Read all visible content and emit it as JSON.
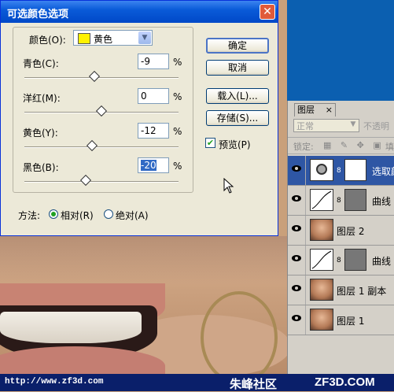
{
  "dialog": {
    "title": "可选颜色选项",
    "close_symbol": "✕",
    "colors_label": "颜色(O):",
    "colors_value": "黄色",
    "sliders": [
      {
        "label": "青色(C):",
        "value": "-9",
        "unit": "%",
        "level_percent": -9
      },
      {
        "label": "洋红(M):",
        "value": "0",
        "unit": "%",
        "level_percent": 0
      },
      {
        "label": "黄色(Y):",
        "value": "-12",
        "unit": "%",
        "level_percent": -12
      },
      {
        "label": "黑色(B):",
        "value": "-20",
        "unit": "%",
        "level_percent": -20
      }
    ],
    "buttons": {
      "ok": "确定",
      "cancel": "取消",
      "load": "载入(L)...",
      "save": "存储(S)..."
    },
    "preview_label": "预览(P)",
    "preview_checked": true,
    "method_label": "方法:",
    "method_relative": "相对(R)",
    "method_absolute": "绝对(A)",
    "method_selected": "relative",
    "accent_color": "#0a5bd8",
    "swatch_color": "#fff200"
  },
  "layers_panel": {
    "tab": "图层",
    "tab_close": "×",
    "blend_mode": "正常",
    "opacity_label": "不透明",
    "lock_label": "锁定:",
    "lock_icons": "▦ ✎ ✥ ▣",
    "fill_label": "填",
    "layers": [
      {
        "name": "选取颜",
        "selected": true,
        "thumb": "adjust",
        "mask": "mask-white"
      },
      {
        "name": "曲线",
        "selected": false,
        "thumb": "curve",
        "mask": "mask"
      },
      {
        "name": "图层 2",
        "selected": false,
        "thumb": "face",
        "mask": ""
      },
      {
        "name": "曲线",
        "selected": false,
        "thumb": "curve",
        "mask": "mask"
      },
      {
        "name": "图层 1 副本",
        "selected": false,
        "thumb": "face",
        "mask": ""
      },
      {
        "name": "图层 1",
        "selected": false,
        "thumb": "face",
        "mask": ""
      }
    ]
  },
  "footer": {
    "url": "http://www.zf3d.com",
    "community": "朱峰社区",
    "brand": "ZF3D.COM"
  }
}
